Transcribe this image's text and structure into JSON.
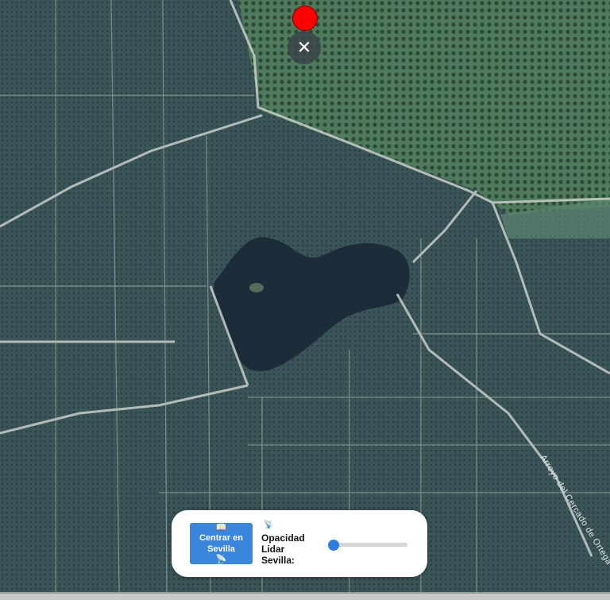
{
  "map": {
    "street_label": "Arroyo del Cercado de Ortega",
    "colors": {
      "land": "#3b5458",
      "forest": "#456b55",
      "water": "#1c2c38",
      "roads": "#c9cfc9"
    }
  },
  "marker": {
    "icon": "red-location-dot",
    "color": "#ff0000"
  },
  "close_button": {
    "icon": "close-icon",
    "glyph": "✕"
  },
  "panel": {
    "center_button": {
      "icon": "book-icon",
      "icon_glyph": "📖",
      "label": "Centrar en Sevilla",
      "trailing_icon": "satellite-icon",
      "trailing_glyph": "📡"
    },
    "opacity_label": "Opacidad\nLidar\nSevilla:",
    "opacity_icon": {
      "icon": "satellite-icon",
      "glyph": "📡"
    },
    "opacity_slider": {
      "value": 0.0,
      "min": 0,
      "max": 1
    }
  }
}
